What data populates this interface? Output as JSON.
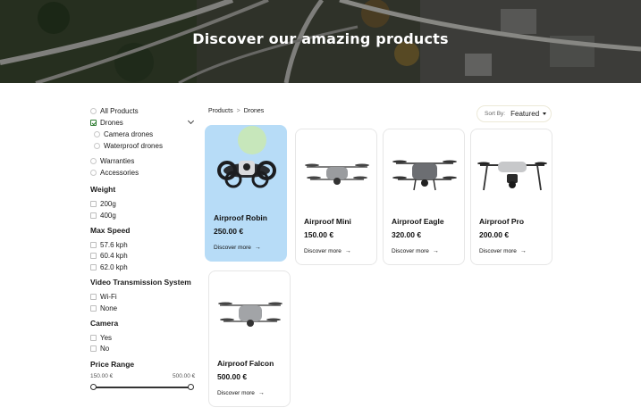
{
  "hero": {
    "title": "Discover our amazing products"
  },
  "sidebar": {
    "categories": [
      {
        "label": "All Products",
        "checked": false
      },
      {
        "label": "Drones",
        "checked": true
      },
      {
        "label": "Camera drones",
        "checked": false
      },
      {
        "label": "Waterproof drones",
        "checked": false
      },
      {
        "label": "Warranties",
        "checked": false
      },
      {
        "label": "Accessories",
        "checked": false
      }
    ],
    "weight": {
      "title": "Weight",
      "options": [
        "200g",
        "400g"
      ]
    },
    "max_speed": {
      "title": "Max Speed",
      "options": [
        "57.6 kph",
        "60.4 kph",
        "62.0 kph"
      ]
    },
    "video_transmission": {
      "title": "Video Transmission System",
      "options": [
        "Wi-Fi",
        "None"
      ]
    },
    "camera": {
      "title": "Camera",
      "options": [
        "Yes",
        "No"
      ]
    },
    "price_range": {
      "title": "Price Range",
      "min": "150.00 €",
      "max": "500.00 €"
    }
  },
  "breadcrumb": {
    "items": [
      "Products",
      "Drones"
    ],
    "separator": ">"
  },
  "sort": {
    "label": "Sort By:",
    "value": "Featured"
  },
  "products": [
    {
      "name": "Airproof Robin",
      "price": "250.00 €",
      "cta": "Discover more",
      "arrow": "→",
      "icon": "fpv-drone-icon",
      "highlighted": true
    },
    {
      "name": "Airproof Mini",
      "price": "150.00 €",
      "cta": "Discover more",
      "arrow": "→",
      "icon": "quadcopter-icon"
    },
    {
      "name": "Airproof Eagle",
      "price": "320.00 €",
      "cta": "Discover more",
      "arrow": "→",
      "icon": "quadcopter-icon"
    },
    {
      "name": "Airproof Pro",
      "price": "200.00 €",
      "cta": "Discover more",
      "arrow": "→",
      "icon": "pro-drone-icon"
    },
    {
      "name": "Airproof Falcon",
      "price": "500.00 €",
      "cta": "Discover more",
      "arrow": "→",
      "icon": "quadcopter-icon"
    }
  ],
  "colors": {
    "accent": "#b7dcf7",
    "check": "#2e7d32"
  }
}
